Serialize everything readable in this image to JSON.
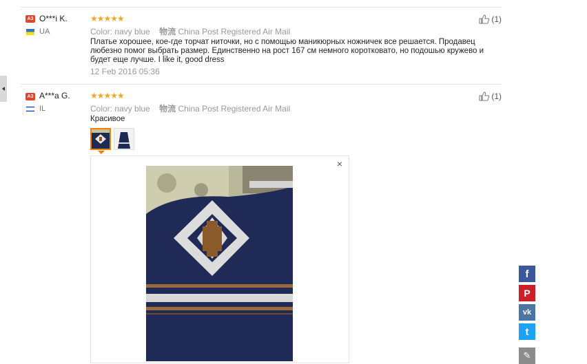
{
  "reviews": [
    {
      "badge": "A3",
      "user": "O***i K.",
      "country": "UA",
      "stars": "★★★★★",
      "color_label": "Color:",
      "color_value": "navy blue",
      "shipping_label": "物流",
      "shipping_value": "China Post Registered Air Mail",
      "text": "Платье хорошее, кое-где торчат ниточки, но с помощью маникюрных ножничек все решается. Продавец любезно помог выбрать размер. Единственно на рост 167 см немного коротковато, но подошью кружево и будет еще лучше. I like it, good dress",
      "date": "12 Feb 2016 05:36",
      "likes": "(1)"
    },
    {
      "badge": "A3",
      "user": "A***a G.",
      "country": "IL",
      "stars": "★★★★★",
      "color_label": "Color:",
      "color_value": "navy blue",
      "shipping_label": "物流",
      "shipping_value": "China Post Registered Air Mail",
      "text": "Красивое",
      "likes": "(1)"
    }
  ],
  "viewer": {
    "close": "×"
  },
  "social": [
    {
      "name": "facebook",
      "glyph": "f",
      "color": "#3b5998"
    },
    {
      "name": "pinterest",
      "glyph": "P",
      "color": "#cb2027"
    },
    {
      "name": "vk",
      "glyph": "vk",
      "color": "#4c75a3"
    },
    {
      "name": "twitter",
      "glyph": "t",
      "color": "#1da1f2"
    },
    {
      "name": "edit",
      "glyph": "✎",
      "color": "#8c8c8c"
    }
  ],
  "icons": {
    "left_tab": "chevron-left-icon",
    "like": "thumbs-up-icon",
    "close": "close-icon",
    "flag_ua": "ukraine-flag-icon",
    "flag_il": "israel-flag-icon"
  }
}
